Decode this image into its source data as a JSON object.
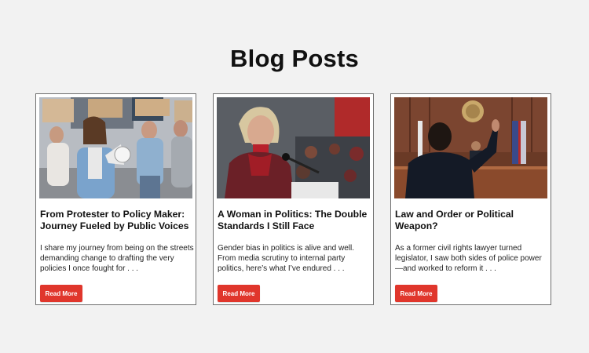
{
  "page": {
    "title": "Blog Posts"
  },
  "posts": [
    {
      "title": "From Protester to Policy Maker: Journey Fueled by Public Voices",
      "excerpt": "I share my journey from being on the streets demanding change to drafting the very policies I once fought for . . .",
      "button_label": "Read More",
      "image_alt": "Protest march with megaphone"
    },
    {
      "title": "A Woman in Politics: The Double Standards I Still Face",
      "excerpt": "Gender bias in politics is alive and well. From media scrutiny to internal party politics, here’s what I’ve endured . . .",
      "button_label": "Read More",
      "image_alt": "Woman speaking at a podium"
    },
    {
      "title": "Law and Order or Political Weapon?",
      "excerpt": "As a former civil rights lawyer turned legislator, I saw both sides of police power—and worked to reform it . . .",
      "button_label": "Read More",
      "image_alt": "Man raising hand in courtroom"
    }
  ],
  "colors": {
    "accent": "#e0362c",
    "background": "#f2f2f2",
    "card": "#ffffff"
  }
}
